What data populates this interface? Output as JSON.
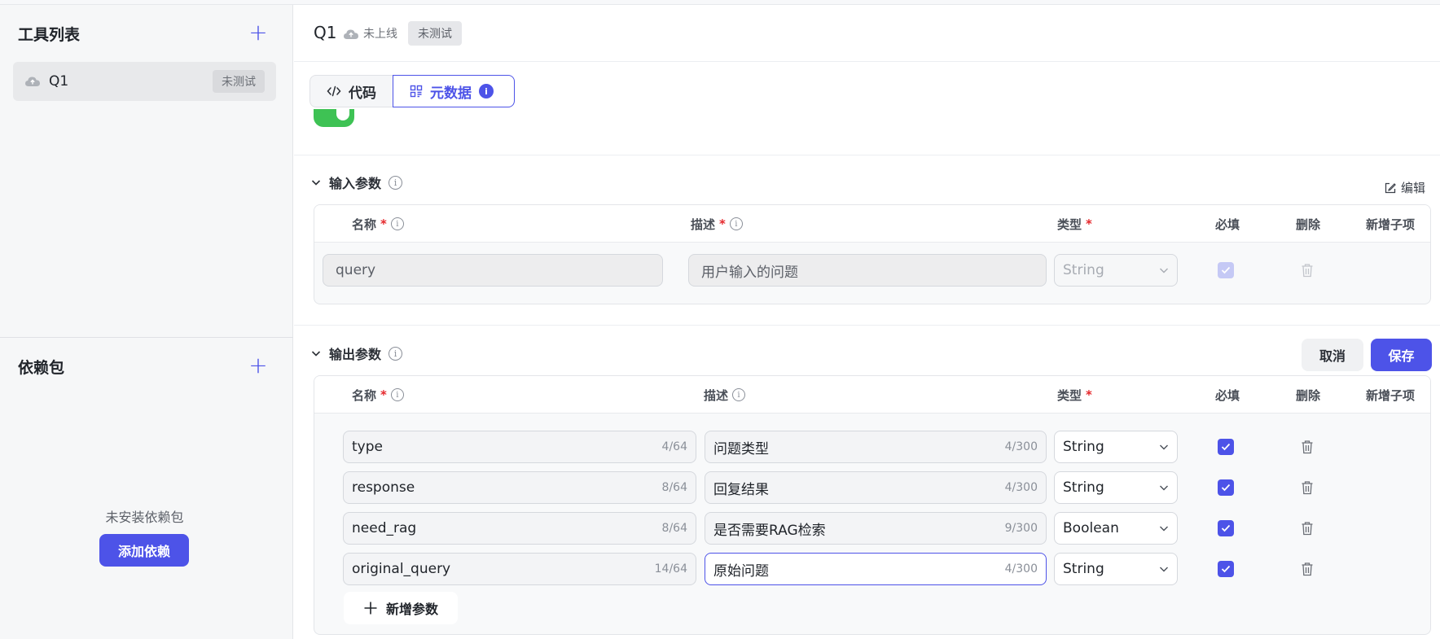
{
  "sidebar": {
    "tools_title": "工具列表",
    "tools": [
      {
        "name": "Q1",
        "badge": "未测试"
      }
    ],
    "deps_title": "依赖包",
    "deps_empty": "未安装依赖包",
    "add_dep_label": "添加依赖"
  },
  "header": {
    "title": "Q1",
    "status": "未上线",
    "badge": "未测试"
  },
  "tabs": [
    {
      "label": "代码",
      "icon": "code-icon"
    },
    {
      "label": "元数据",
      "icon": "grid-icon",
      "dot": "i"
    }
  ],
  "input_section": {
    "title": "输入参数",
    "edit_label": "编辑",
    "columns": {
      "name": "名称",
      "desc": "描述",
      "type": "类型",
      "required": "必填",
      "delete": "删除",
      "add_child": "新增子项"
    },
    "required_mark": "*",
    "rows": [
      {
        "name": "query",
        "desc": "用户输入的问题",
        "type": "String",
        "required": true
      }
    ]
  },
  "output_section": {
    "title": "输出参数",
    "cancel_label": "取消",
    "save_label": "保存",
    "columns": {
      "name": "名称",
      "desc": "描述",
      "type": "类型",
      "required": "必填",
      "delete": "删除",
      "add_child": "新增子项"
    },
    "required_mark": "*",
    "rows": [
      {
        "name": "type",
        "name_count": "4/64",
        "desc": "问题类型",
        "desc_count": "4/300",
        "type": "String",
        "required": true
      },
      {
        "name": "response",
        "name_count": "8/64",
        "desc": "回复结果",
        "desc_count": "4/300",
        "type": "String",
        "required": true
      },
      {
        "name": "need_rag",
        "name_count": "8/64",
        "desc": "是否需要RAG检索",
        "desc_count": "9/300",
        "type": "Boolean",
        "required": true
      },
      {
        "name": "original_query",
        "name_count": "14/64",
        "desc": "原始问题",
        "desc_count": "4/300",
        "type": "String",
        "required": true
      }
    ],
    "add_param_label": "新增参数"
  },
  "colors": {
    "accent": "#4d53e8",
    "toggle_on": "#3ec254",
    "required": "#e5272b"
  }
}
